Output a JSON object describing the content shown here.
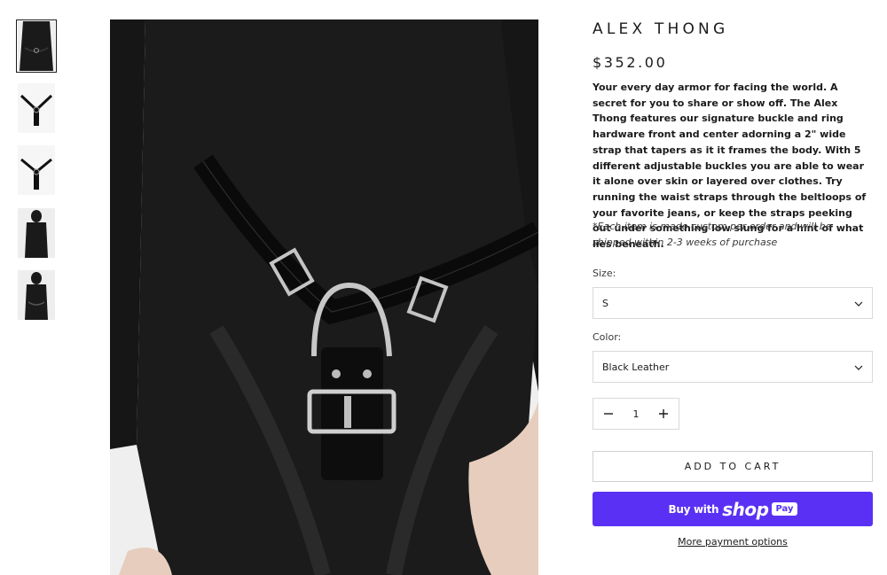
{
  "product": {
    "title": "ALEX THONG",
    "price": "$352.00",
    "description": "Your every day armor for facing the world. A secret for you to share or show off. The Alex Thong features our signature buckle and ring hardware front and center adorning a 2\" wide strap that tapers as it it frames the body. With 5 different adjustable buckles you are able to wear it alone over skin or layered over clothes. Try running the waist straps through the beltloops of your favorite jeans, or keep the straps peeking out under something low slung for a hint of what lies beneath.",
    "note": "*Each item is made custom per order and will be shipped within 2-3 weeks of purchase"
  },
  "options": {
    "size_label": "Size:",
    "size_value": "S",
    "color_label": "Color:",
    "color_value": "Black Leather"
  },
  "quantity": {
    "value": "1",
    "minus_icon": "minus-icon",
    "plus_icon": "plus-icon"
  },
  "actions": {
    "add_to_cart": "ADD TO CART",
    "shop_pay_buy": "Buy with",
    "shop_pay_shop": "shop",
    "shop_pay_pay": "Pay",
    "more_payment": "More payment options"
  },
  "colors": {
    "accent": "#5a31f4",
    "text": "#1c1b1b",
    "border": "#d9d9d9"
  },
  "thumbnails": [
    {
      "name": "thumb-1",
      "active": true
    },
    {
      "name": "thumb-2",
      "active": false
    },
    {
      "name": "thumb-3",
      "active": false
    },
    {
      "name": "thumb-4",
      "active": false
    },
    {
      "name": "thumb-5",
      "active": false
    }
  ]
}
